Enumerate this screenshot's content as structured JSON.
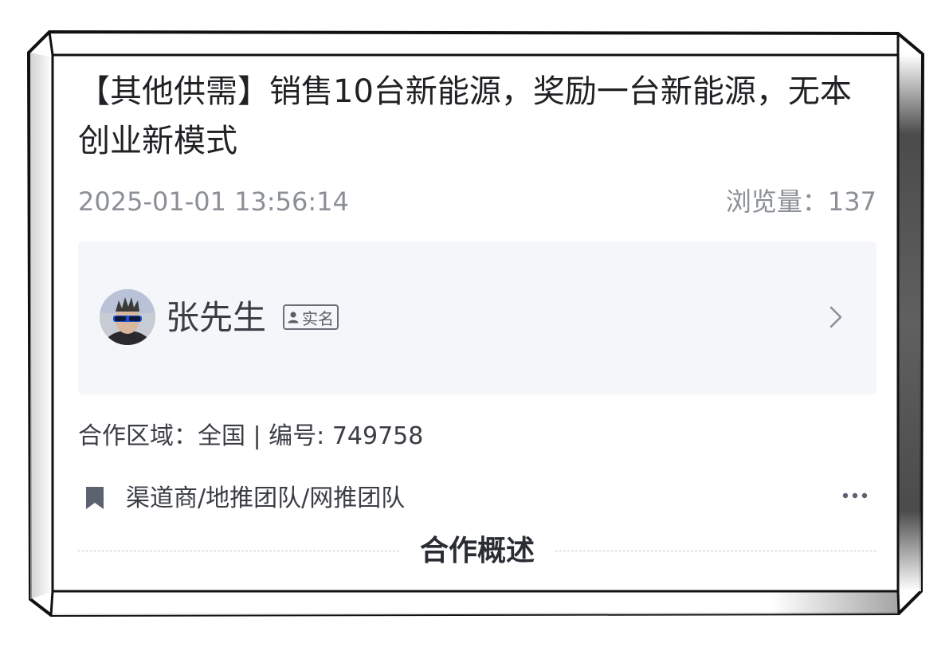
{
  "post": {
    "title": "【其他供需】销售10台新能源，奖励一台新能源，无本创业新模式",
    "date": "2025-01-01 13:56:14",
    "views": "浏览量：137"
  },
  "author": {
    "name": "张先生",
    "verified_label": "实名",
    "avatar_icon": "user-avatar",
    "chevron_icon": "chevron-right-icon"
  },
  "details": {
    "info": "合作区域：全国 | 编号: 749758",
    "tags": "渠道商/地推团队/网推团队",
    "bookmark_icon": "bookmark-icon",
    "more_icon": "more-icon"
  },
  "section": {
    "title": "合作概述"
  },
  "colors": {
    "text_primary": "#202124",
    "text_secondary": "#8b8f96",
    "card_bg": "#f5f6fa",
    "icon": "#5b6270"
  }
}
